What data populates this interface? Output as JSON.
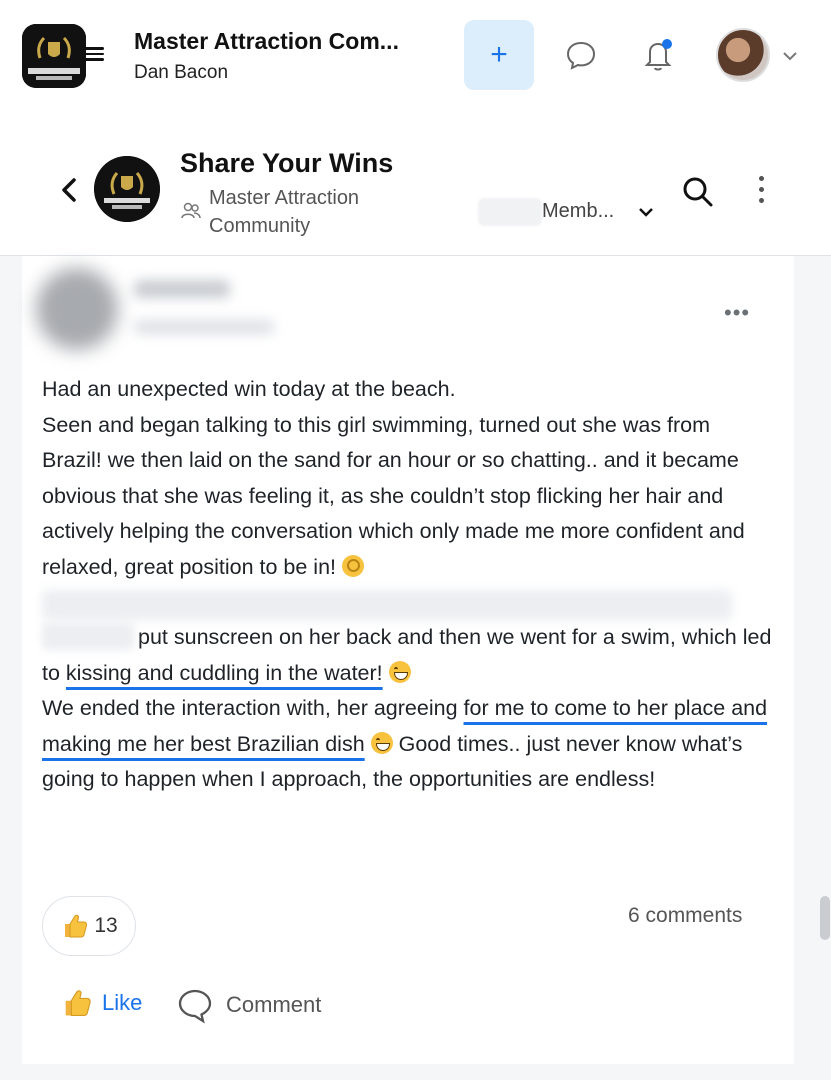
{
  "app": {
    "title": "Master Attraction Com...",
    "user": "Dan Bacon",
    "new_label": "+",
    "logo_text": "MASTER ATTRACTION COMMUNITY"
  },
  "group": {
    "title": "Share Your Wins",
    "community_name": "Master Attraction Community",
    "members_label": "Memb...",
    "logo_text": "MASTER ATTRACTION COMMUNITY"
  },
  "post": {
    "menu_label": "•••",
    "line1": "Had an unexpected win today at the beach.",
    "para1": "Seen and began talking to this girl swimming, turned out she was from Brazil! we then laid on the sand for an hour or so chatting.. and it became obvious that she was feeling it, as she couldn’t stop flicking her hair and actively helping the conversation which only made me more confident and relaxed, great position to be in!",
    "para2_a": "put sunscreen on her back and then we went for a swim, which led to",
    "para2_hl": "kissing and cuddling in the water!",
    "para3_a": "We ended the interaction with, her agreeing",
    "para3_hl": "for me to come to her place and making me her best Brazilian dish",
    "para3_b": "Good times.. just never know what’s going to happen when I approach, the opportunities are endless!",
    "reaction_count": "13",
    "comments_label": "6 comments",
    "like_label": "Like",
    "comment_label": "Comment"
  },
  "colors": {
    "accent": "#1a73e8",
    "plus_bg": "#dceefc",
    "feed_bg": "#f5f6f8",
    "gold": "#c9a94a"
  },
  "icons": [
    "hamburger-icon",
    "plus-icon",
    "chat-bubble-icon",
    "bell-icon",
    "chevron-down-icon",
    "back-arrow-icon",
    "people-icon",
    "search-icon",
    "more-vertical-icon",
    "more-horizontal-icon",
    "thumbs-up-icon",
    "comment-icon",
    "ok-hand-emoji",
    "grin-emoji"
  ]
}
